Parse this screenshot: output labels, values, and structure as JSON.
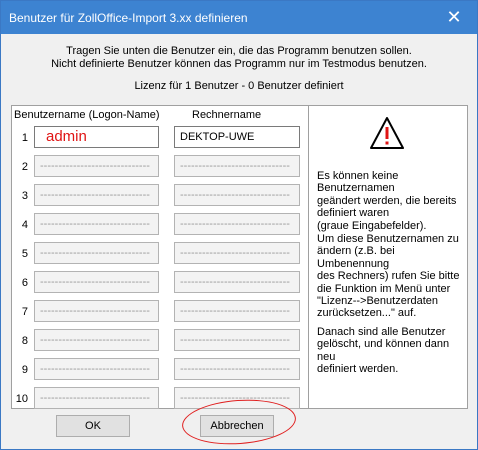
{
  "window": {
    "title": "Benutzer für ZollOffice-Import 3.xx definieren",
    "close_label": "✕"
  },
  "intro": {
    "line1": "Tragen Sie unten die Benutzer ein, die das Programm benutzen sollen.",
    "line2": "Nicht definierte Benutzer können das Programm nur im Testmodus benutzen.",
    "license": "Lizenz für 1 Benutzer - 0 Benutzer definiert"
  },
  "columns": {
    "user": "Benutzername (Logon-Name)",
    "computer": "Rechnername"
  },
  "rows": [
    {
      "num": "1",
      "user": "admin",
      "computer": "DEKTOP-UWE"
    },
    {
      "num": "2",
      "user": "------------------------------",
      "computer": "------------------------------"
    },
    {
      "num": "3",
      "user": "------------------------------",
      "computer": "------------------------------"
    },
    {
      "num": "4",
      "user": "------------------------------",
      "computer": "------------------------------"
    },
    {
      "num": "5",
      "user": "------------------------------",
      "computer": "------------------------------"
    },
    {
      "num": "6",
      "user": "------------------------------",
      "computer": "------------------------------"
    },
    {
      "num": "7",
      "user": "------------------------------",
      "computer": "------------------------------"
    },
    {
      "num": "8",
      "user": "------------------------------",
      "computer": "------------------------------"
    },
    {
      "num": "9",
      "user": "------------------------------",
      "computer": "------------------------------"
    },
    {
      "num": "10",
      "user": "------------------------------",
      "computer": "------------------------------"
    }
  ],
  "info": {
    "icon": "warning-icon",
    "p1": [
      "Es können keine Benutzernamen",
      "geändert werden, die bereits",
      "definiert waren",
      "(graue Eingabefelder)."
    ],
    "p2": [
      "Um diese Benutzernamen zu",
      "ändern (z.B. bei Umbenennung",
      "des Rechners) rufen Sie bitte",
      "die Funktion im Menü unter",
      "\"Lizenz-->Benutzerdaten",
      "zurücksetzen...\" auf."
    ],
    "p3": [
      "Danach sind alle Benutzer",
      "gelöscht, und können dann neu",
      "definiert werden."
    ]
  },
  "buttons": {
    "ok": "OK",
    "cancel": "Abbrechen"
  },
  "colors": {
    "titlebar": "#3d83d1",
    "highlight_circle": "#e02020",
    "active_user_text": "#e01414"
  }
}
